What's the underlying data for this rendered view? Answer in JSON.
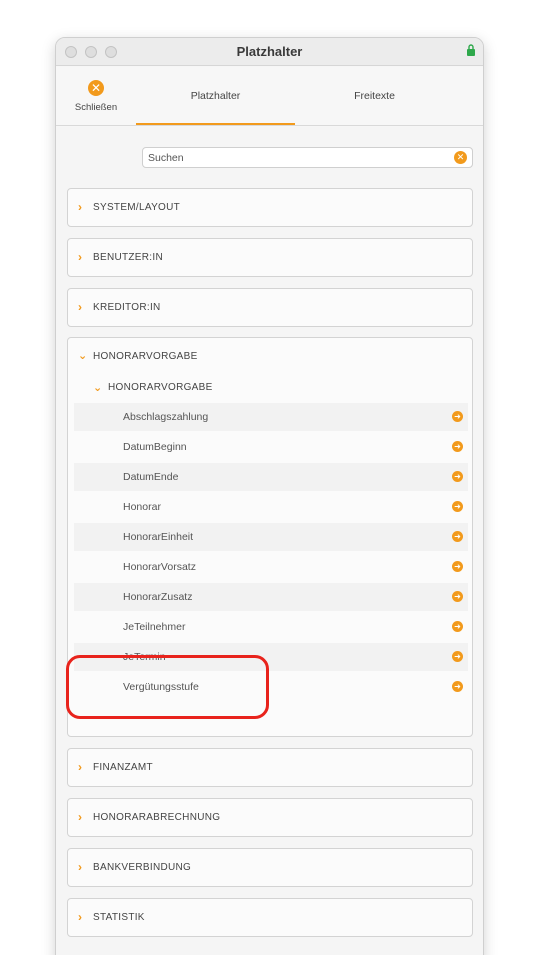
{
  "window": {
    "title": "Platzhalter"
  },
  "toolbar": {
    "close_label": "Schließen",
    "tabs": [
      {
        "label": "Platzhalter",
        "active": true
      },
      {
        "label": "Freitexte",
        "active": false
      }
    ]
  },
  "search": {
    "value": "Suchen"
  },
  "sections": {
    "system": "SYSTEM/LAYOUT",
    "benutzer": "BENUTZER:IN",
    "kreditor": "KREDITOR:IN",
    "honorarvorgabe": "HONORARVORGABE",
    "finanzamt": "FINANZAMT",
    "honorarabrechnung": "HONORARABRECHNUNG",
    "bankverbindung": "BANKVERBINDUNG",
    "statistik": "STATISTIK"
  },
  "subsection": {
    "label": "HONORARVORGABE"
  },
  "items": [
    "Abschlagszahlung",
    "DatumBeginn",
    "DatumEnde",
    "Honorar",
    "HonorarEinheit",
    "HonorarVorsatz",
    "HonorarZusatz",
    "JeTeilnehmer",
    "JeTermin",
    "Vergütungsstufe"
  ],
  "colors": {
    "accent": "#f29a1c",
    "highlight": "#e8231c"
  },
  "icons": {
    "close": "close-circle-icon",
    "chevron_right": "chevron-right-icon",
    "chevron_down": "chevron-down-icon",
    "item_arrow": "arrow-right-circle-icon",
    "lock": "lock-icon"
  }
}
